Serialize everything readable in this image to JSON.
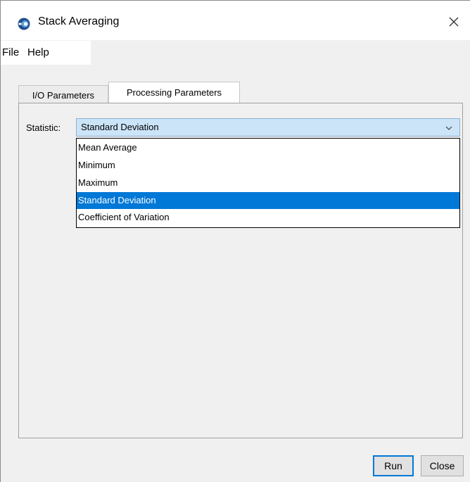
{
  "window": {
    "title": "Stack Averaging",
    "app_icon": "esa-snap-icon",
    "close_icon": "close-icon"
  },
  "menu": {
    "file_label": "File",
    "help_label": "Help"
  },
  "tabs": [
    {
      "label": "I/O Parameters",
      "active": false
    },
    {
      "label": "Processing Parameters",
      "active": true
    }
  ],
  "processing": {
    "statistic_label": "Statistic:",
    "selected_value": "Standard Deviation",
    "dropdown_icon": "chevron-down-icon",
    "options": [
      "Mean Average",
      "Minimum",
      "Maximum",
      "Standard Deviation",
      "Coefficient of Variation"
    ],
    "selected_index": 3
  },
  "buttons": {
    "run_label": "Run",
    "close_label": "Close"
  },
  "colors": {
    "selection": "#0078d7",
    "combo_background": "#cce4f7"
  }
}
